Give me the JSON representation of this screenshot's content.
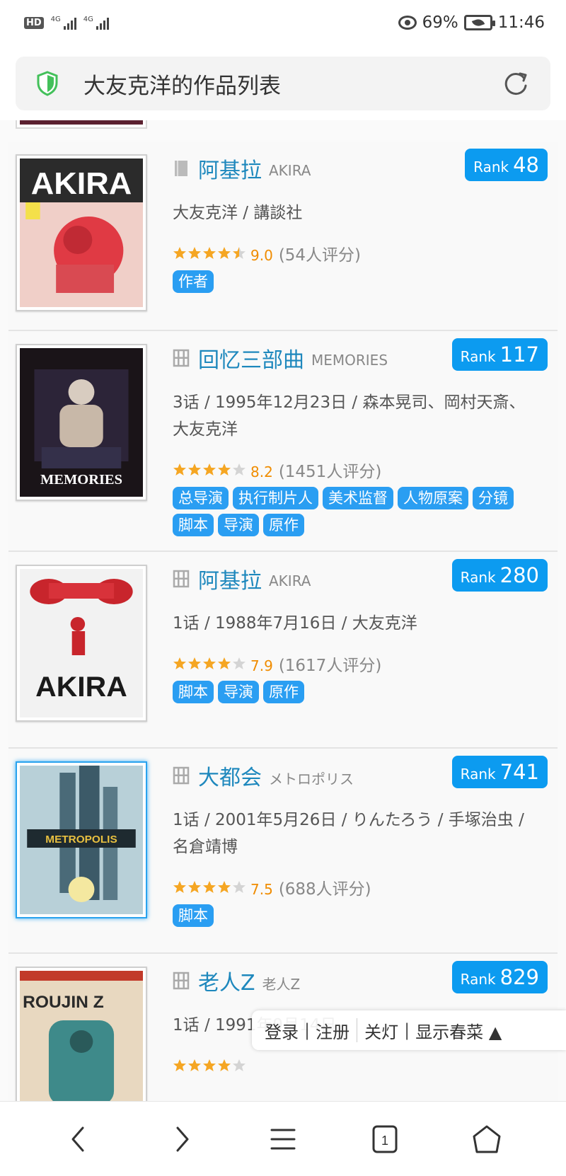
{
  "status_bar": {
    "hd": "HD",
    "net1": "4G",
    "net2": "4G",
    "battery": "69%",
    "time": "11:46"
  },
  "address_bar": {
    "title": "大友克洋的作品列表"
  },
  "items": [
    {
      "title": "阿基拉",
      "subtitle": "AKIRA",
      "type": "book",
      "rank_label": "Rank",
      "rank": "48",
      "meta": "大友克洋 / 講談社",
      "stars": 4.5,
      "score": "9.0",
      "votes": "(54人评分)",
      "tags": [
        "作者"
      ],
      "cover_text": "AKIRA",
      "cover_colors": [
        "#e8323a",
        "#2a2a2a",
        "#f4d8d0"
      ]
    },
    {
      "title": "回忆三部曲",
      "subtitle": "MEMORIES",
      "type": "film",
      "rank_label": "Rank",
      "rank": "117",
      "meta": "3话 / 1995年12月23日 / 森本晃司、岡村天斎、大友克洋",
      "stars": 4,
      "score": "8.2",
      "votes": "(1451人评分)",
      "tags": [
        "总导演",
        "执行制片人",
        "美术监督",
        "人物原案",
        "分镜",
        "脚本",
        "导演",
        "原作"
      ],
      "cover_text": "MEMORIES",
      "cover_colors": [
        "#1a1018",
        "#c9b8a8",
        "#3c2a48"
      ]
    },
    {
      "title": "阿基拉",
      "subtitle": "AKIRA",
      "type": "film",
      "rank_label": "Rank",
      "rank": "280",
      "meta": "1话 / 1988年7月16日 / 大友克洋",
      "stars": 4,
      "score": "7.9",
      "votes": "(1617人评分)",
      "tags": [
        "脚本",
        "导演",
        "原作"
      ],
      "cover_text": "AKIRA",
      "cover_colors": [
        "#f4f4f4",
        "#d8222a",
        "#1a1a1a"
      ]
    },
    {
      "title": "大都会",
      "subtitle": "メトロポリス",
      "type": "film",
      "rank_label": "Rank",
      "rank": "741",
      "meta": "1话 / 2001年5月26日 / りんたろう / 手塚治虫 / 名倉靖博",
      "stars": 4,
      "score": "7.5",
      "votes": "(688人评分)",
      "tags": [
        "脚本"
      ],
      "cover_text": "METROPOLIS",
      "cover_colors": [
        "#3a6e84",
        "#bcd4da",
        "#e2b23a"
      ]
    },
    {
      "title": "老人Z",
      "subtitle": "老人Z",
      "type": "film",
      "rank_label": "Rank",
      "rank": "829",
      "meta": "1话 / 1991年9月14日",
      "stars": 4,
      "score": "",
      "votes": "",
      "tags": [],
      "cover_text": "ROUJIN Z",
      "cover_colors": [
        "#c23a2a",
        "#3e8a8a",
        "#f2e8d8"
      ]
    }
  ],
  "float_bar": {
    "login": "登录",
    "sep": "|",
    "register": "注册",
    "lights": "关灯",
    "show": "显示春菜 ▲"
  },
  "bottom_nav": {
    "tabs_count": "1"
  },
  "colors": {
    "accent": "#0c9bf0",
    "title": "#1e88bd",
    "star": "#f5a623"
  }
}
